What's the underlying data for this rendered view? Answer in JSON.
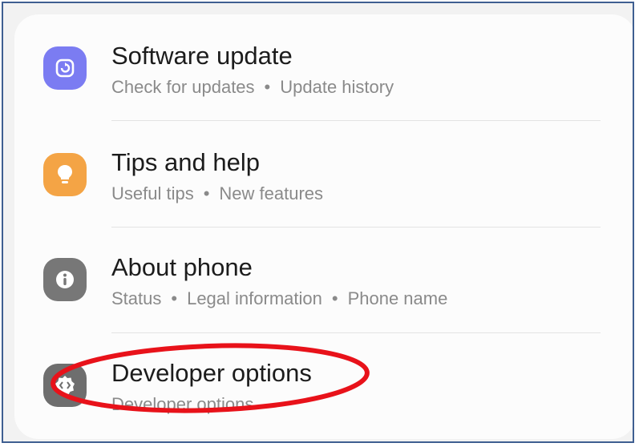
{
  "colors": {
    "frame_border": "#3f5f91",
    "software_update_icon": "#7b7cf2",
    "tips_icon": "#f4a445",
    "about_icon": "#777777",
    "developer_icon": "#6e6e6e",
    "annotation_ellipse": "#e8121a"
  },
  "items": [
    {
      "title": "Software update",
      "subtitle_parts": [
        "Check for updates",
        "Update history"
      ],
      "icon": "software-update-icon"
    },
    {
      "title": "Tips and help",
      "subtitle_parts": [
        "Useful tips",
        "New features"
      ],
      "icon": "lightbulb-icon"
    },
    {
      "title": "About phone",
      "subtitle_parts": [
        "Status",
        "Legal information",
        "Phone name"
      ],
      "icon": "info-icon"
    },
    {
      "title": "Developer options",
      "subtitle_parts": [
        "Developer options"
      ],
      "icon": "developer-gear-icon"
    }
  ],
  "separator": "•"
}
